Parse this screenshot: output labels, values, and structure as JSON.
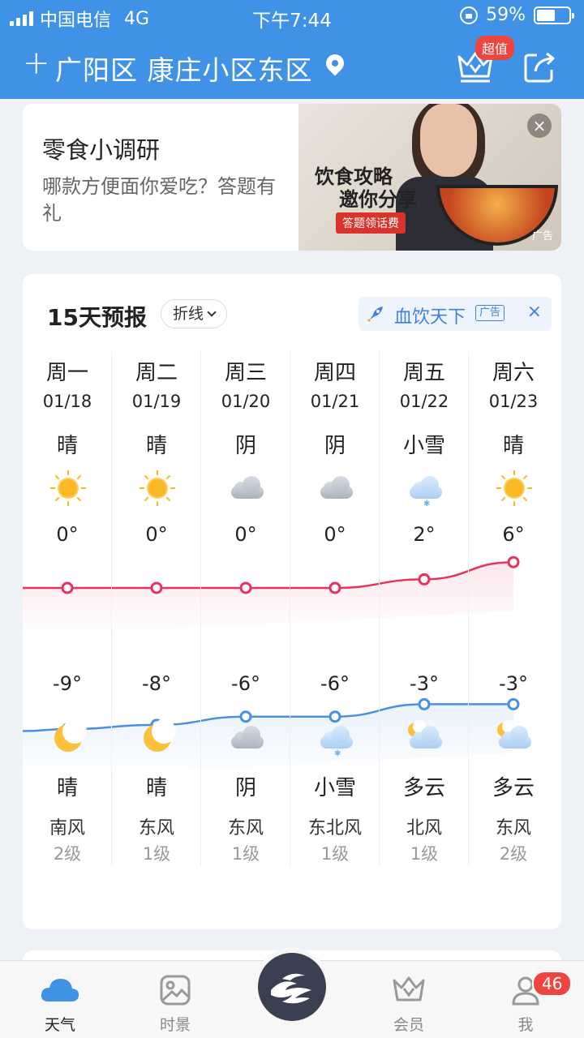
{
  "status": {
    "carrier": "中国电信",
    "network": "4G",
    "time": "下午7:44",
    "battery": "59%",
    "battery_level": 0.59
  },
  "header": {
    "location": "广阳区 康庄小区东区",
    "badge": "超值"
  },
  "ad": {
    "title": "零食小调研",
    "desc": "哪款方便面你爱吃？答题有礼",
    "img_line1": "饮食攻略",
    "img_line2": "邀你分享",
    "img_tag": "答题领话费",
    "img_label": "广告",
    "close": "×"
  },
  "forecast": {
    "title": "15天预报",
    "toggle": "折线",
    "promo": {
      "text": "血饮天下",
      "tag": "广告",
      "close": "×"
    },
    "days": [
      {
        "weekday": "周一",
        "date": "01/18",
        "cond_day": "晴",
        "icon_day": "sun-icon",
        "high": "0°",
        "low": "-9°",
        "icon_night": "moon-icon",
        "cond_night": "晴",
        "wind": "南风",
        "level": "2级"
      },
      {
        "weekday": "周二",
        "date": "01/19",
        "cond_day": "晴",
        "icon_day": "sun-icon",
        "high": "0°",
        "low": "-8°",
        "icon_night": "moon-icon",
        "cond_night": "晴",
        "wind": "东风",
        "level": "1级"
      },
      {
        "weekday": "周三",
        "date": "01/20",
        "cond_day": "阴",
        "icon_day": "cloud-icon",
        "high": "0°",
        "low": "-6°",
        "icon_night": "cloud-icon",
        "cond_night": "阴",
        "wind": "东风",
        "level": "1级"
      },
      {
        "weekday": "周四",
        "date": "01/21",
        "cond_day": "阴",
        "icon_day": "cloud-icon",
        "high": "0°",
        "low": "-6°",
        "icon_night": "snow-icon",
        "cond_night": "小雪",
        "wind": "东北风",
        "level": "1级"
      },
      {
        "weekday": "周五",
        "date": "01/22",
        "cond_day": "小雪",
        "icon_day": "snow-icon",
        "high": "2°",
        "low": "-3°",
        "icon_night": "moon-cloud-icon",
        "cond_night": "多云",
        "wind": "北风",
        "level": "1级"
      },
      {
        "weekday": "周六",
        "date": "01/23",
        "cond_day": "晴",
        "icon_day": "sun-icon",
        "high": "6°",
        "low": "-3°",
        "icon_night": "moon-cloud-icon",
        "cond_night": "多云",
        "wind": "东风",
        "level": "2级"
      }
    ]
  },
  "chart_data": {
    "type": "line",
    "x": [
      "01/18",
      "01/19",
      "01/20",
      "01/21",
      "01/22",
      "01/23"
    ],
    "series": [
      {
        "values": [
          0,
          0,
          0,
          0,
          2,
          6
        ],
        "color": "#e8325e"
      },
      {
        "values": [
          -9,
          -8,
          -6,
          -6,
          -3,
          -3
        ],
        "color": "#4a90e2"
      }
    ]
  },
  "nav": {
    "items": [
      "天气",
      "时景",
      "会员",
      "我"
    ],
    "badge": "46"
  },
  "colors": {
    "brand": "#3f92e6",
    "accent_red": "#f0453e",
    "high_line": "#e8325e",
    "low_line": "#4a90e2"
  }
}
